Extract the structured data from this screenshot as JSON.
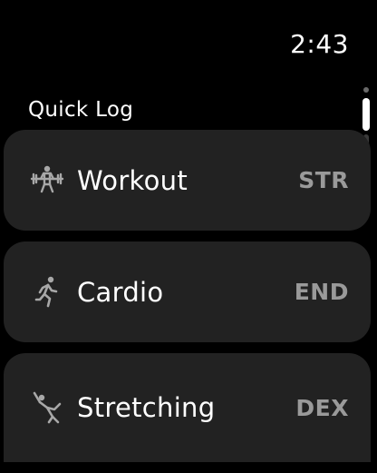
{
  "status": {
    "time": "2:43"
  },
  "section": {
    "title": "Quick Log"
  },
  "items": [
    {
      "label": "Workout",
      "tag": "STR",
      "icon": "weightlifting-icon"
    },
    {
      "label": "Cardio",
      "tag": "END",
      "icon": "running-icon"
    },
    {
      "label": "Stretching",
      "tag": "DEX",
      "icon": "stretching-icon"
    }
  ],
  "colors": {
    "background": "#000000",
    "card": "#222222",
    "text": "#ffffff",
    "tag": "#9a9a9a",
    "icon": "#a8a8a8"
  }
}
